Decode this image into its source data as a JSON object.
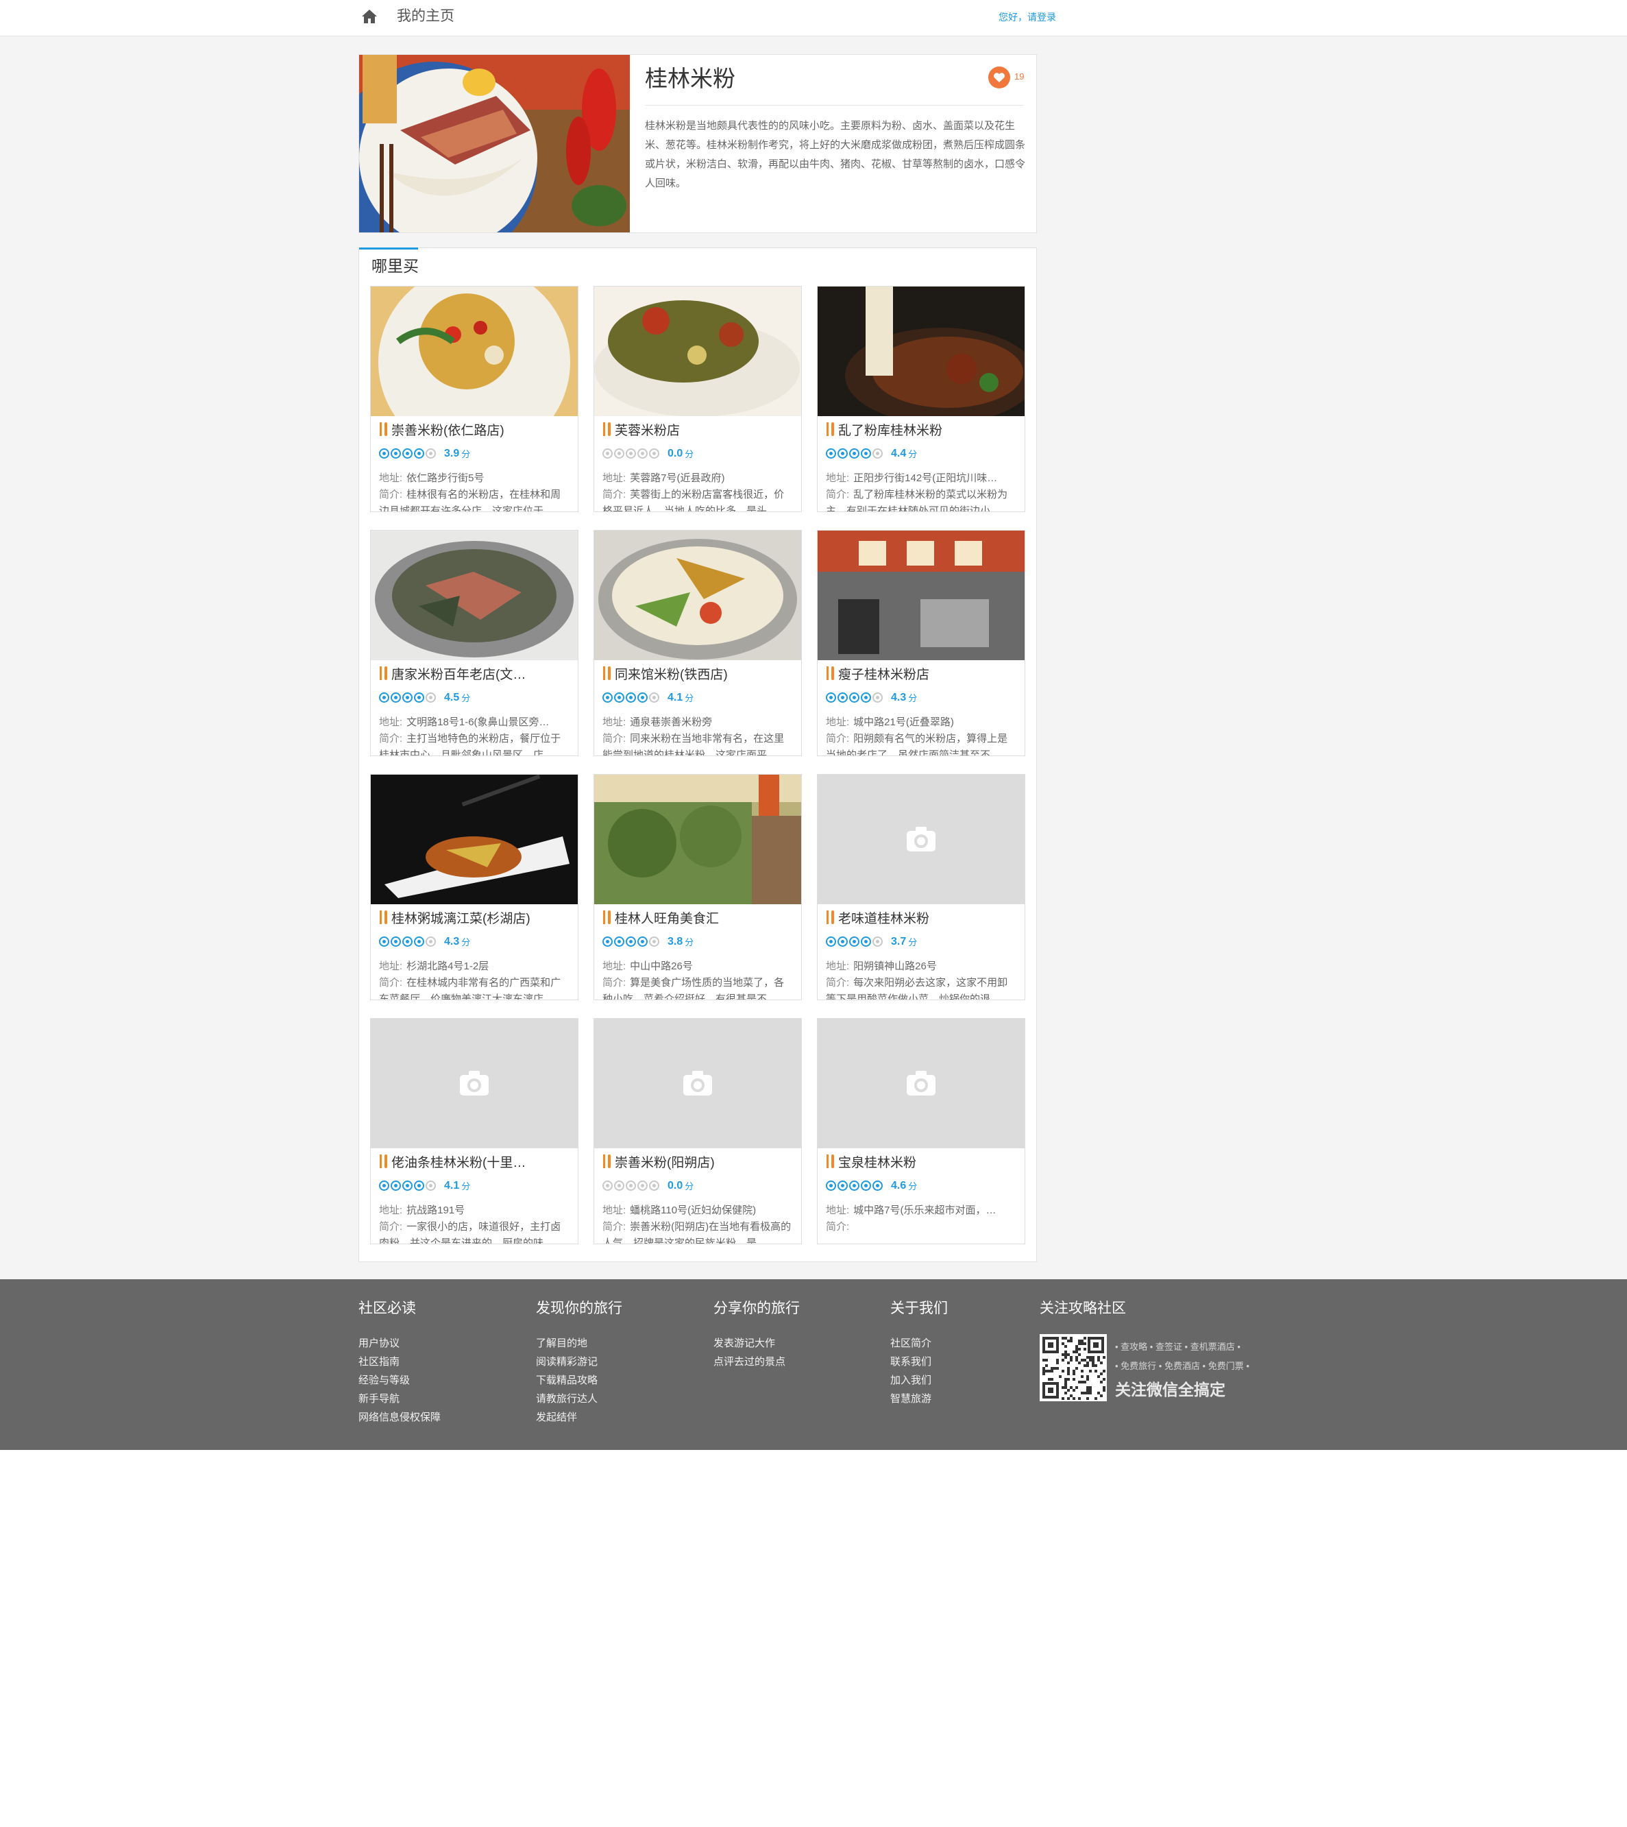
{
  "topbar": {
    "home_label": "我的主页",
    "login_text": "您好，请登录"
  },
  "intro": {
    "title": "桂林米粉",
    "like_count": "19",
    "description": "桂林米粉是当地颇具代表性的的风味小吃。主要原料为粉、卤水、盖面菜以及花生米、葱花等。桂林米粉制作考究，将上好的大米磨成浆做成粉团，煮熟后压榨成圆条或片状，米粉洁白、软滑，再配以由牛肉、猪肉、花椒、甘草等熬制的卤水，口感令人回味。"
  },
  "buy": {
    "title": "哪里买",
    "address_key": "地址:",
    "intro_key": "简介:",
    "score_unit": "分",
    "shops": [
      {
        "name": "崇善米粉(依仁路店)",
        "score": "3.9",
        "stars": 4,
        "address": "依仁路步行街5号",
        "intro": "桂林很有名的米粉店，在桂林和周边县城都开有许多分店，这家店位于"
      },
      {
        "name": "芙蓉米粉店",
        "score": "0.0",
        "stars": 0,
        "address": "芙蓉路7号(近县政府)",
        "intro": "芙蓉街上的米粉店富客栈很近，价格平易近人，当地人吃的比多，是头"
      },
      {
        "name": "乱了粉库桂林米粉",
        "score": "4.4",
        "stars": 4,
        "address": "正阳步行街142号(正阳坑川味…",
        "intro": "乱了粉库桂林米粉的菜式以米粉为主，有别于在桂林随处可见的街边小"
      },
      {
        "name": "唐家米粉百年老店(文…",
        "score": "4.5",
        "stars": 4,
        "address": "文明路18号1-6(象鼻山景区旁…",
        "intro": "主打当地特色的米粉店，餐厅位于桂林市中心，且毗邻象山风景区，店"
      },
      {
        "name": "同来馆米粉(铁西店)",
        "score": "4.1",
        "stars": 4,
        "address": "通泉巷崇善米粉旁",
        "intro": "同来米粉在当地非常有名，在这里能尝到地道的桂林米粉，这家店面平"
      },
      {
        "name": "瘦子桂林米粉店",
        "score": "4.3",
        "stars": 4,
        "address": "城中路21号(近叠翠路)",
        "intro": "阳朔颇有名气的米粉店，算得上是当地的老店了，虽然店面简洁甚至不"
      },
      {
        "name": "桂林粥城漓江菜(杉湖店)",
        "score": "4.3",
        "stars": 4,
        "address": "杉湖北路4号1-2层",
        "intro": "在桂林城内非常有名的广西菜和广东菜餐厅，价廉物美漓江大漓东漓店"
      },
      {
        "name": "桂林人旺角美食汇",
        "score": "3.8",
        "stars": 4,
        "address": "中山中路26号",
        "intro": "算是美食广场性质的当地菜了，各种小吃、菜肴介绍挺好，有很甚是不"
      },
      {
        "name": "老味道桂林米粉",
        "score": "3.7",
        "stars": 4,
        "address": "阳朔镇神山路26号",
        "intro": "每次来阳朔必去这家，这家不用卸等下是用酸菜作做小菜，炒锅你的退"
      },
      {
        "name": "佬油条桂林米粉(十里…",
        "score": "4.1",
        "stars": 4,
        "address": "抗战路191号",
        "intro": "一家很小的店，味道很好，主打卤肉粉，并这个是东进来的，厨房的味"
      },
      {
        "name": "崇善米粉(阳朔店)",
        "score": "0.0",
        "stars": 0,
        "address": "蟠桃路110号(近妇幼保健院)",
        "intro": "崇善米粉(阳朔店)在当地有看极高的人气，招牌是这家的民族米粉，是"
      },
      {
        "name": "宝泉桂林米粉",
        "score": "4.6",
        "stars": 5,
        "address": "城中路7号(乐乐来超市对面，…",
        "intro": ""
      }
    ]
  },
  "footer": {
    "columns": [
      {
        "title": "社区必读",
        "links": [
          "用户协议",
          "社区指南",
          "经验与等级",
          "新手导航",
          "网络信息侵权保障"
        ]
      },
      {
        "title": "发现你的旅行",
        "links": [
          "了解目的地",
          "阅读精彩游记",
          "下载精品攻略",
          "请教旅行达人",
          "发起结伴"
        ]
      },
      {
        "title": "分享你的旅行",
        "links": [
          "发表游记大作",
          "点评去过的景点"
        ]
      },
      {
        "title": "关于我们",
        "links": [
          "社区简介",
          "联系我们",
          "加入我们",
          "智慧旅游"
        ]
      },
      {
        "title": "关注攻略社区",
        "links": []
      }
    ],
    "qr_tags_1": "• 查攻略 • 查签证 • 查机票酒店 •",
    "qr_tags_2": "• 免费旅行 • 免费酒店 • 免费门票 •",
    "qr_slogan": "关注微信全搞定"
  },
  "colors": {
    "accent": "#1e9ae0",
    "like": "#f0783c",
    "footer_bg": "#676767",
    "page_bg": "#f4f4f4"
  },
  "icons": [
    "home-icon",
    "heart-icon",
    "fork-knife-icon",
    "star-rating-icon",
    "camera-placeholder-icon",
    "qr-code"
  ]
}
